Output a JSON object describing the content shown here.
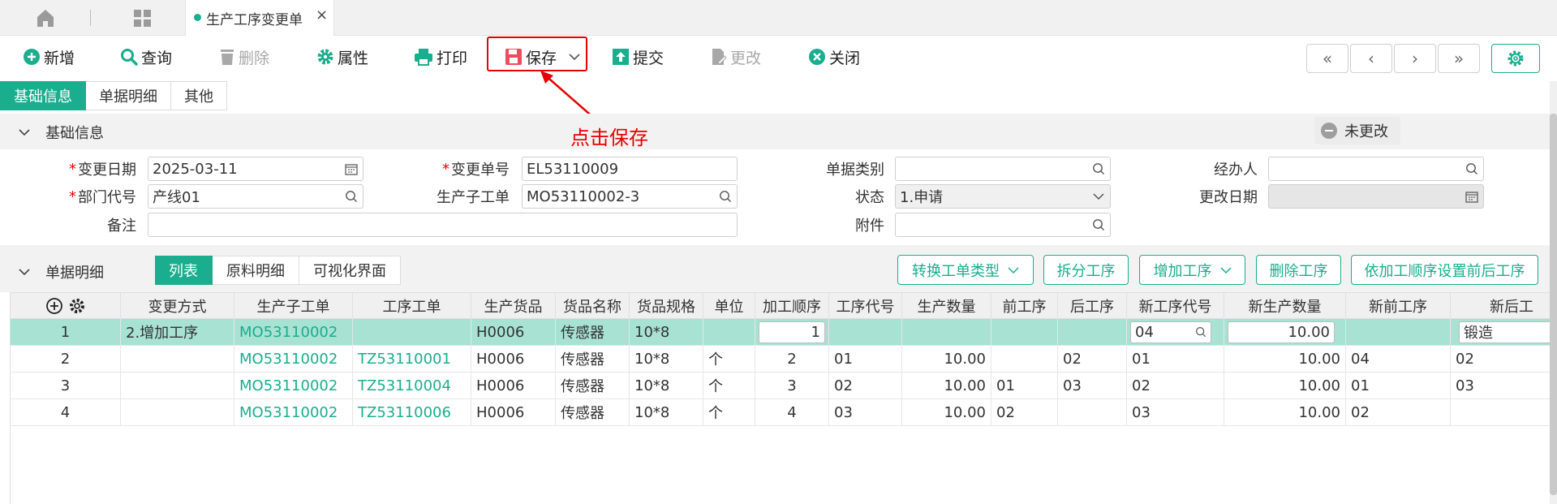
{
  "tab": {
    "title": "生产工序变更单",
    "close": "×"
  },
  "toolbar": {
    "new": "新增",
    "query": "查询",
    "delete": "删除",
    "props": "属性",
    "print": "打印",
    "save": "保存",
    "submit": "提交",
    "edit": "更改",
    "close": "关闭",
    "nav": [
      "«",
      "‹",
      "›",
      "»"
    ]
  },
  "section_tabs": [
    "基础信息",
    "单据明细",
    "其他"
  ],
  "basic": {
    "header": "基础信息",
    "status_badge": "未更改",
    "annotation": "点击保存",
    "fields": {
      "change_date_label": "变更日期",
      "change_date": "2025-03-11",
      "change_no_label": "变更单号",
      "change_no": "EL53110009",
      "doc_type_label": "单据类别",
      "doc_type": "",
      "handler_label": "经办人",
      "handler": "",
      "dept_label": "部门代号",
      "dept": "产线01",
      "sub_order_label": "生产子工单",
      "sub_order": "MO53110002-3",
      "status_label": "状态",
      "status": "1.申请",
      "modify_date_label": "更改日期",
      "modify_date": "",
      "remark_label": "备注",
      "remark": "",
      "attach_label": "附件",
      "attach": ""
    }
  },
  "detail": {
    "header": "单据明细",
    "tabs": [
      "列表",
      "原料明细",
      "可视化界面"
    ],
    "buttons": [
      "转换工单类型",
      "拆分工序",
      "增加工序",
      "删除工序",
      "依加工顺序设置前后工序"
    ],
    "columns": [
      "变更方式",
      "生产子工单",
      "工序工单",
      "生产货品",
      "货品名称",
      "货品规格",
      "单位",
      "加工顺序",
      "工序代号",
      "生产数量",
      "前工序",
      "后工序",
      "新工序代号",
      "新生产数量",
      "新前工序",
      "新后工"
    ],
    "rows": [
      {
        "idx": "1",
        "mode": "2.增加工序",
        "sub": "MO53110002",
        "wo": "",
        "item": "H0006",
        "name": "传感器",
        "spec": "10*8",
        "unit": "",
        "seq": "1",
        "op": "",
        "qty": "",
        "prev": "",
        "next": "",
        "newop": "04",
        "newqty": "10.00",
        "newprev": "",
        "newnext": "锻造"
      },
      {
        "idx": "2",
        "mode": "",
        "sub": "MO53110002",
        "wo": "TZ53110001",
        "item": "H0006",
        "name": "传感器",
        "spec": "10*8",
        "unit": "个",
        "seq": "2",
        "op": "01",
        "qty": "10.00",
        "prev": "",
        "next": "02",
        "newop": "01",
        "newqty": "10.00",
        "newprev": "04",
        "newnext": "02"
      },
      {
        "idx": "3",
        "mode": "",
        "sub": "MO53110002",
        "wo": "TZ53110004",
        "item": "H0006",
        "name": "传感器",
        "spec": "10*8",
        "unit": "个",
        "seq": "3",
        "op": "02",
        "qty": "10.00",
        "prev": "01",
        "next": "03",
        "newop": "02",
        "newqty": "10.00",
        "newprev": "01",
        "newnext": "03"
      },
      {
        "idx": "4",
        "mode": "",
        "sub": "MO53110002",
        "wo": "TZ53110006",
        "item": "H0006",
        "name": "传感器",
        "spec": "10*8",
        "unit": "个",
        "seq": "4",
        "op": "03",
        "qty": "10.00",
        "prev": "02",
        "next": "",
        "newop": "03",
        "newqty": "10.00",
        "newprev": "02",
        "newnext": ""
      }
    ]
  },
  "colors": {
    "accent": "#1aad8e",
    "selected_row": "#a7e2d3",
    "highlight": "#e60000"
  }
}
